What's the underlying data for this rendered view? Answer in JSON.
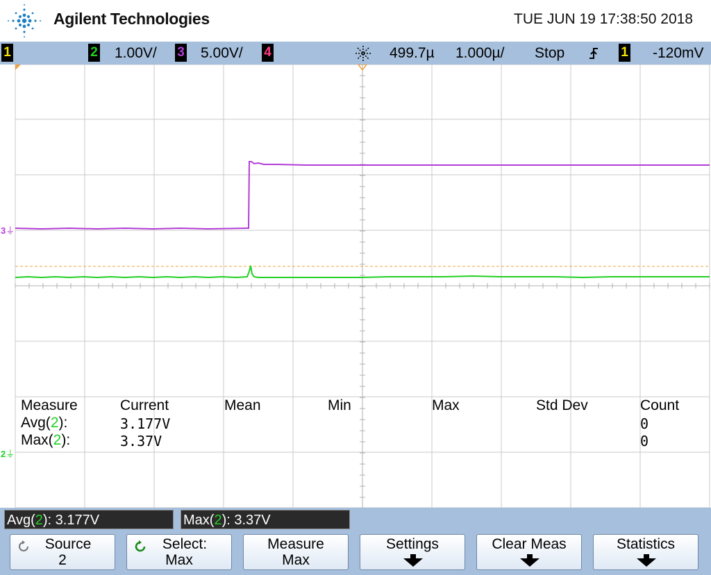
{
  "header": {
    "brand": "Agilent Technologies",
    "datetime": "TUE JUN 19 17:38:50 2018"
  },
  "channel_bar": {
    "ch1_num": "1",
    "ch2_num": "2",
    "ch2_scale": "1.00V/",
    "ch3_num": "3",
    "ch3_scale": "5.00V/",
    "ch4_num": "4",
    "time_delay": "499.7µ",
    "time_scale": "1.000µ/",
    "run_state": "Stop",
    "trig_source": "1",
    "trig_level": "-120mV",
    "colors": {
      "ch1": "#f4e600",
      "ch2": "#22d022",
      "ch3": "#b33cd6",
      "ch4": "#ff3c80"
    }
  },
  "markers": {
    "ch3": "3",
    "ch2": "2"
  },
  "measure_table": {
    "headers": [
      "Measure",
      "Current",
      "Mean",
      "Min",
      "Max",
      "Std Dev",
      "Count"
    ],
    "rows": [
      {
        "fn": "Avg(",
        "ch": "2",
        "close": "):",
        "current": "3.177V",
        "count": "0"
      },
      {
        "fn": "Max(",
        "ch": "2",
        "close": "):",
        "current": "3.37V",
        "count": "0"
      }
    ]
  },
  "readouts": [
    {
      "fn": "Avg(",
      "ch": "2",
      "rest": "): 3.177V"
    },
    {
      "fn": "Max(",
      "ch": "2",
      "rest": "): 3.37V"
    }
  ],
  "softkeys": [
    {
      "line1": "Source",
      "line2": "2",
      "icon": "rotate-knob-icon"
    },
    {
      "line1": "Select:",
      "line2": "Max",
      "icon": "rotate-knob-green-icon"
    },
    {
      "line1": "Measure",
      "line2": "Max",
      "icon": ""
    },
    {
      "line1": "Settings",
      "line2": "",
      "icon": "down-arrow-icon"
    },
    {
      "line1": "Clear Meas",
      "line2": "",
      "icon": "down-arrow-icon"
    },
    {
      "line1": "Statistics",
      "line2": "",
      "icon": "down-arrow-icon"
    }
  ]
}
